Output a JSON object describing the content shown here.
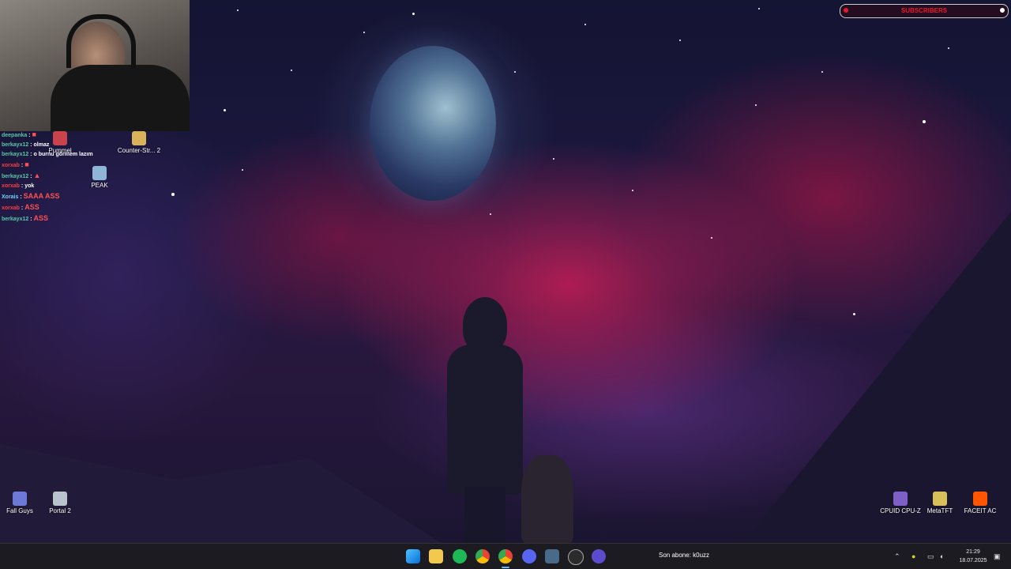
{
  "overlay": {
    "subscribers_label": "SUBSCRIBERS",
    "chat": [
      {
        "user": "deepanka",
        "msg": "",
        "user_color": "teal"
      },
      {
        "user": "berkayx12",
        "msg": "olmaz",
        "user_color": "teal"
      },
      {
        "user": "berkayx12",
        "msg": "o burnu görmem lazım",
        "user_color": "teal"
      },
      {
        "user": "xorxab",
        "msg": "",
        "user_color": "red"
      },
      {
        "user": "berkayx12",
        "msg": "",
        "user_color": "teal"
      },
      {
        "user": "xorxab",
        "msg": "yok",
        "user_color": "red"
      },
      {
        "user": "Xorais",
        "msg": "SAAA ASS",
        "user_color": "blue"
      },
      {
        "user": "xorxab",
        "msg": "ASS",
        "user_color": "red"
      },
      {
        "user": "berkayx12",
        "msg": "ASS",
        "user_color": "teal"
      }
    ]
  },
  "desktop": {
    "icons": [
      {
        "label": "Pummel",
        "icon": "pummel-icon"
      },
      {
        "label": "Counter-Str... 2",
        "icon": "counter-strike-icon"
      },
      {
        "label": "PEAK",
        "icon": "peak-icon"
      },
      {
        "label": "Fall Guys",
        "icon": "fall-guys-icon"
      },
      {
        "label": "Portal 2",
        "icon": "portal-icon"
      },
      {
        "label": "CPUID CPU-Z",
        "icon": "cpuz-icon"
      },
      {
        "label": "MetaTFT",
        "icon": "metatft-icon"
      },
      {
        "label": "FACEIT AC",
        "icon": "faceit-icon"
      }
    ]
  },
  "taskbar": {
    "apps": [
      "windows-start-icon",
      "file-explorer-icon",
      "spotify-icon",
      "chrome-icon",
      "chrome-icon",
      "discord-icon",
      "game-launcher-icon",
      "obs-icon",
      "app-icon"
    ],
    "son_abone": "Son abone: k0uzz",
    "clock_time": "21:29",
    "clock_date": "18.07.2025"
  },
  "colors": {
    "accent": "#5bb7ff",
    "subscriber_red": "#e8182c"
  }
}
